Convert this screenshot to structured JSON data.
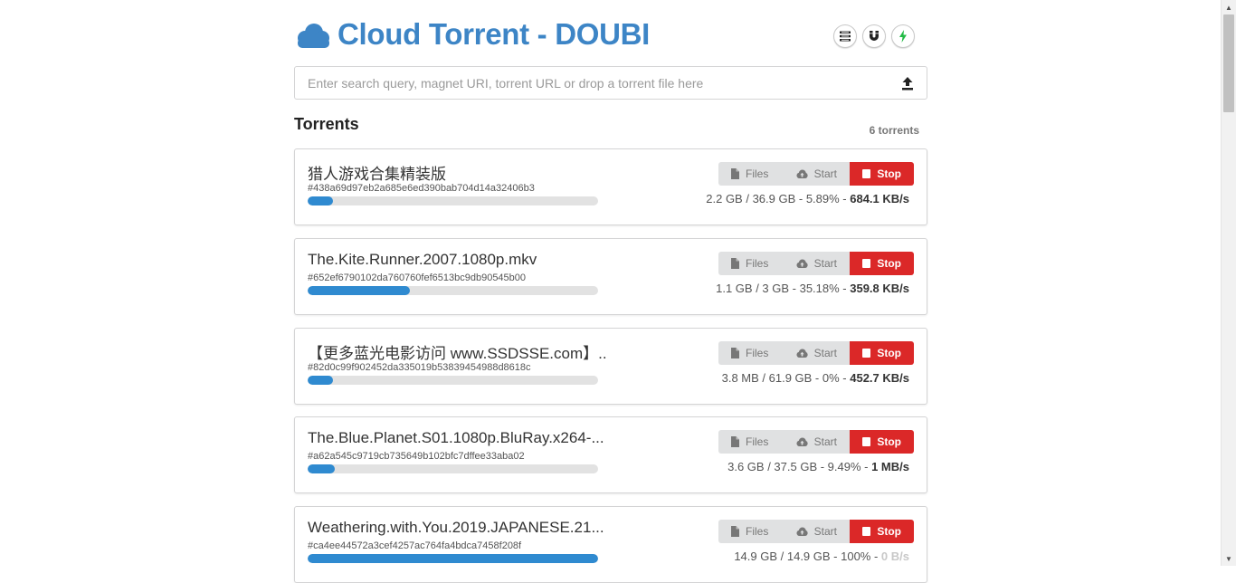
{
  "app": {
    "title": "Cloud Torrent - DOUBI"
  },
  "search": {
    "placeholder": "Enter search query, magnet URI, torrent URL or drop a torrent file here"
  },
  "header_buttons": [
    "list-icon",
    "magnet-icon",
    "bolt-icon"
  ],
  "torrents_section": {
    "title": "Torrents",
    "count_label": "6 torrents"
  },
  "buttons": {
    "files": "Files",
    "start": "Start",
    "stop": "Stop"
  },
  "colors": {
    "brand": "#3d85c6",
    "progress": "#2f8ad0",
    "stop": "#db2828",
    "bolt": "#21ba45"
  },
  "torrents": [
    {
      "name": "猎人游戏合集精装版",
      "hash": "#438a69d97eb2a685e6ed390bab704d14a32406b3",
      "progress": 5.89,
      "sizes": "2.2 GB / 36.9 GB - 5.89% - ",
      "speed": "684.1 KB/s"
    },
    {
      "name": "The.Kite.Runner.2007.1080p.mkv",
      "hash": "#652ef6790102da760760fef6513bc9db90545b00",
      "progress": 35.18,
      "sizes": "1.1 GB / 3 GB - 35.18% - ",
      "speed": "359.8 KB/s"
    },
    {
      "name": "【更多蓝光电影访问 www.SSDSSE.com】...",
      "hash": "#82d0c99f902452da335019b53839454988d8618c",
      "progress": 0,
      "sizes": "3.8 MB / 61.9 GB - 0% - ",
      "speed": "452.7 KB/s"
    },
    {
      "name": "The.Blue.Planet.S01.1080p.BluRay.x264-...",
      "hash": "#a62a545c9719cb735649b102bfc7dffee33aba02",
      "progress": 9.49,
      "sizes": "3.6 GB / 37.5 GB - 9.49% - ",
      "speed": "1 MB/s"
    },
    {
      "name": "Weathering.with.You.2019.JAPANESE.21...",
      "hash": "#ca4ee44572a3cef4257ac764fa4bdca7458f208f",
      "progress": 100,
      "sizes": "14.9 GB / 14.9 GB - 100% - ",
      "speed": "0 B/s"
    }
  ]
}
